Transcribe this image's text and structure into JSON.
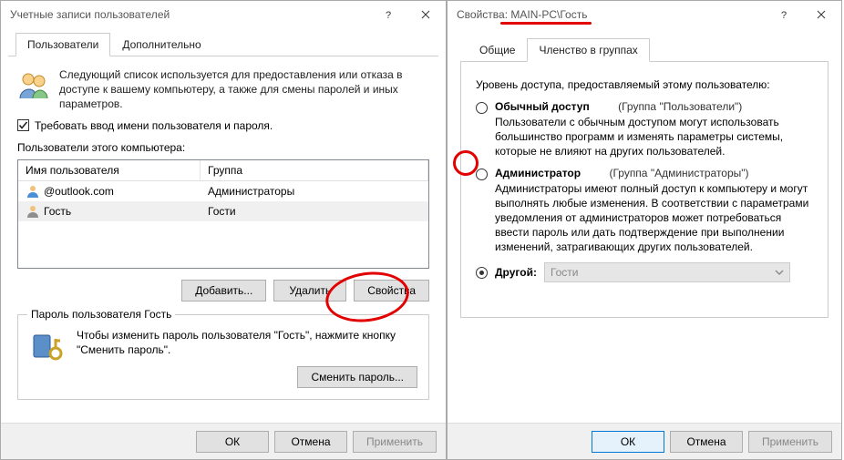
{
  "win1": {
    "title": "Учетные записи пользователей",
    "tabs": {
      "users": "Пользователи",
      "advanced": "Дополнительно"
    },
    "intro": "Следующий список используется для предоставления или отказа в доступе к вашему компьютеру, а также для смены паролей и иных параметров.",
    "require_cred": "Требовать ввод имени пользователя и пароля.",
    "users_label": "Пользователи этого компьютера:",
    "col_user": "Имя пользователя",
    "col_group": "Группа",
    "rows": [
      {
        "name": "  @outlook.com",
        "group": "Администраторы"
      },
      {
        "name": "Гость",
        "group": "Гости"
      }
    ],
    "btn_add": "Добавить...",
    "btn_remove": "Удалить",
    "btn_props": "Свойства",
    "groupbox_title": "Пароль пользователя Гость",
    "pwd_text": "Чтобы изменить пароль пользователя \"Гость\", нажмите кнопку \"Сменить пароль\".",
    "btn_change_pwd": "Сменить пароль...",
    "btn_ok": "ОК",
    "btn_cancel": "Отмена",
    "btn_apply": "Применить"
  },
  "win2": {
    "title": "Свойства: MAIN-PC\\Гость",
    "tabs": {
      "general": "Общие",
      "membership": "Членство в группах"
    },
    "access_label": "Уровень доступа, предоставляемый этому пользователю:",
    "options": {
      "standard": {
        "title": "Обычный доступ",
        "group": "(Группа \"Пользователи\")",
        "text": "Пользователи с обычным доступом могут использовать большинство программ и изменять параметры системы, которые не влияют на других пользователей."
      },
      "admin": {
        "title": "Администратор",
        "group": "(Группа \"Администраторы\")",
        "text": "Администраторы имеют полный доступ к компьютеру и могут выполнять любые изменения. В соответствии с параметрами уведомления от администраторов может потребоваться ввести пароль или дать подтверждение при выполнении изменений, затрагивающих других пользователей."
      },
      "other": {
        "title": "Другой:",
        "value": "Гости"
      }
    },
    "btn_ok": "ОК",
    "btn_cancel": "Отмена",
    "btn_apply": "Применить"
  }
}
